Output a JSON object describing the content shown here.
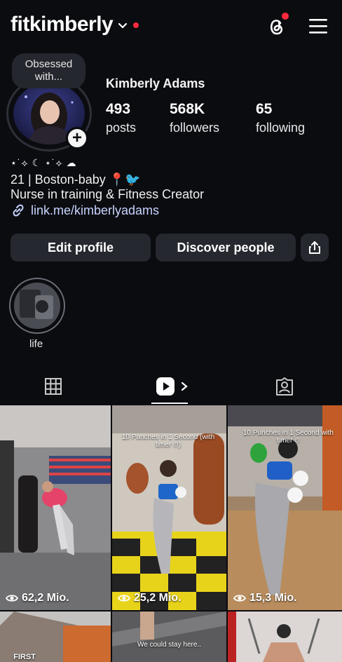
{
  "header": {
    "username": "fitkimberly",
    "has_notification_dot": true,
    "threads_icon": "threads-icon",
    "menu_icon": "hamburger-menu-icon"
  },
  "profile": {
    "note": [
      "Obsessed",
      "with..."
    ],
    "full_name": "Kimberly Adams",
    "stats": {
      "posts": {
        "value": "493",
        "label": "posts"
      },
      "followers": {
        "value": "568K",
        "label": "followers"
      },
      "following": {
        "value": "65",
        "label": "following"
      }
    },
    "bio": {
      "emoji_line": "⋆˙⟡ ☾ ⋆˙⟡ ☁",
      "line1": "21 | Boston-baby 📍🐦",
      "line2": "Nurse in training & Fitness Creator",
      "link": "link.me/kimberlyadams"
    }
  },
  "buttons": {
    "edit_profile": "Edit profile",
    "discover_people": "Discover people",
    "share_icon": "share-icon"
  },
  "highlights": [
    {
      "label": "life"
    }
  ],
  "tabs": [
    {
      "name": "grid",
      "icon": "grid-icon"
    },
    {
      "name": "reels",
      "icon": "reels-icon",
      "active": true
    },
    {
      "name": "tagged",
      "icon": "tagged-icon"
    }
  ],
  "reels": [
    {
      "views": "62,2 Mio.",
      "overlay": ""
    },
    {
      "views": "25,2 Mio.",
      "overlay": "10 Punches in 1 Second (with timer ⏲)"
    },
    {
      "views": "15,3 Mio.",
      "overlay": "10 Punches in 1 Second with timer ⏲"
    },
    {
      "views": "",
      "overlay": "FIRST"
    },
    {
      "views": "",
      "overlay": "We could stay here.."
    },
    {
      "views": "",
      "overlay": ""
    }
  ],
  "colors": {
    "background": "#0b0c10",
    "button_bg": "#26282f",
    "link": "#c7d4ff",
    "notification": "#ff2a3d"
  }
}
